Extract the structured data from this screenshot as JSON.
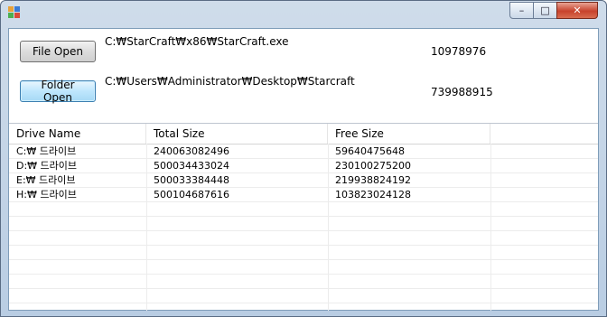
{
  "window": {
    "title": "",
    "controls": {
      "minimize": "–",
      "maximize": "□",
      "close": "✕"
    }
  },
  "file": {
    "button_label": "File Open",
    "path": "C:₩StarCraft₩x86₩StarCraft.exe",
    "size": "10978976"
  },
  "folder": {
    "button_label": "Folder Open",
    "path": "C:₩Users₩Administrator₩Desktop₩Starcraft",
    "size": "739988915"
  },
  "drives": {
    "columns": [
      "Drive Name",
      "Total Size",
      "Free Size",
      ""
    ],
    "rows": [
      [
        "C:₩ 드라이브",
        "240063082496",
        "59640475648"
      ],
      [
        "D:₩ 드라이브",
        "500034433024",
        "230100275200"
      ],
      [
        "E:₩ 드라이브",
        "500033384448",
        "219938824192"
      ],
      [
        "H:₩ 드라이브",
        "500104687616",
        "103823024128"
      ]
    ]
  }
}
